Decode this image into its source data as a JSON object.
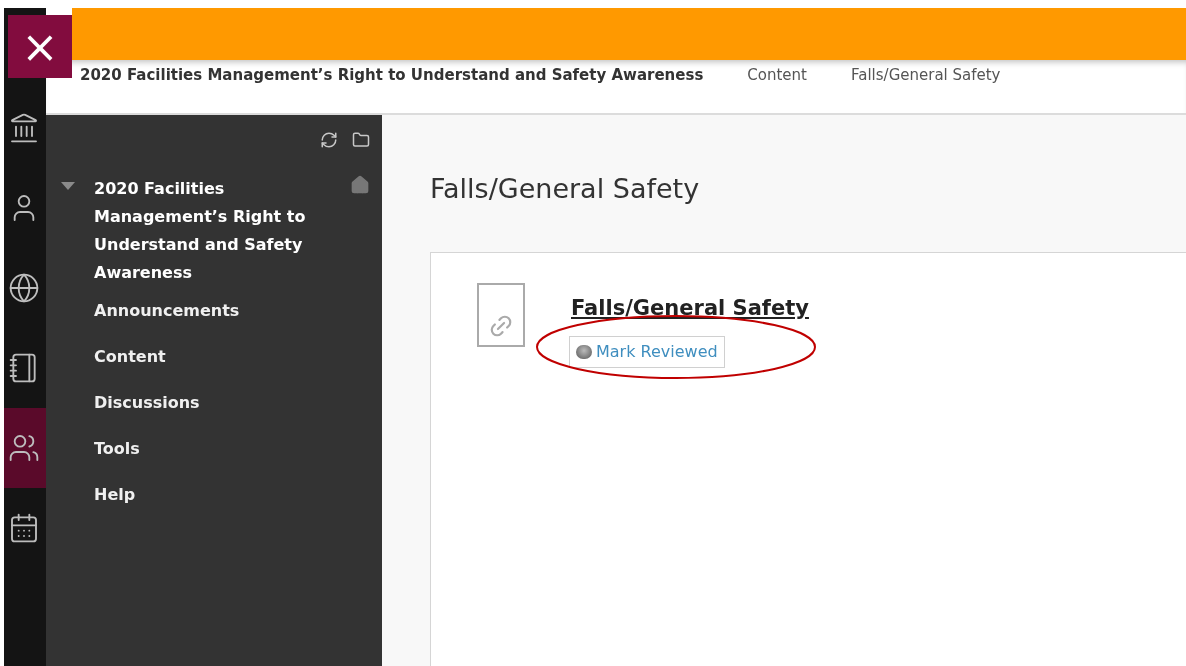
{
  "close_button": {
    "label": "×"
  },
  "rail": [
    {
      "kind": "institution",
      "selected": false
    },
    {
      "kind": "profile",
      "selected": false
    },
    {
      "kind": "globe",
      "selected": false
    },
    {
      "kind": "notebook",
      "selected": false
    },
    {
      "kind": "group",
      "selected": true
    },
    {
      "kind": "calendar",
      "selected": false
    }
  ],
  "breadcrumbs": [
    {
      "label": "2020 Facilities Management’s Right to Understand and Safety Awareness",
      "bold": true
    },
    {
      "label": "Content",
      "bold": false
    },
    {
      "label": "Falls/General Safety",
      "bold": false
    }
  ],
  "course_menu": {
    "title": "2020 Facilities Management’s Right to Understand and Safety Awareness",
    "expanded": true,
    "items": [
      "Announcements",
      "Content",
      "Discussions",
      "Tools",
      "Help"
    ]
  },
  "page_title": "Falls/General Safety",
  "content_item": {
    "title": "Falls/General Safety",
    "mark_button": {
      "label": "Mark Reviewed",
      "reviewed": false
    },
    "annotated": true
  }
}
